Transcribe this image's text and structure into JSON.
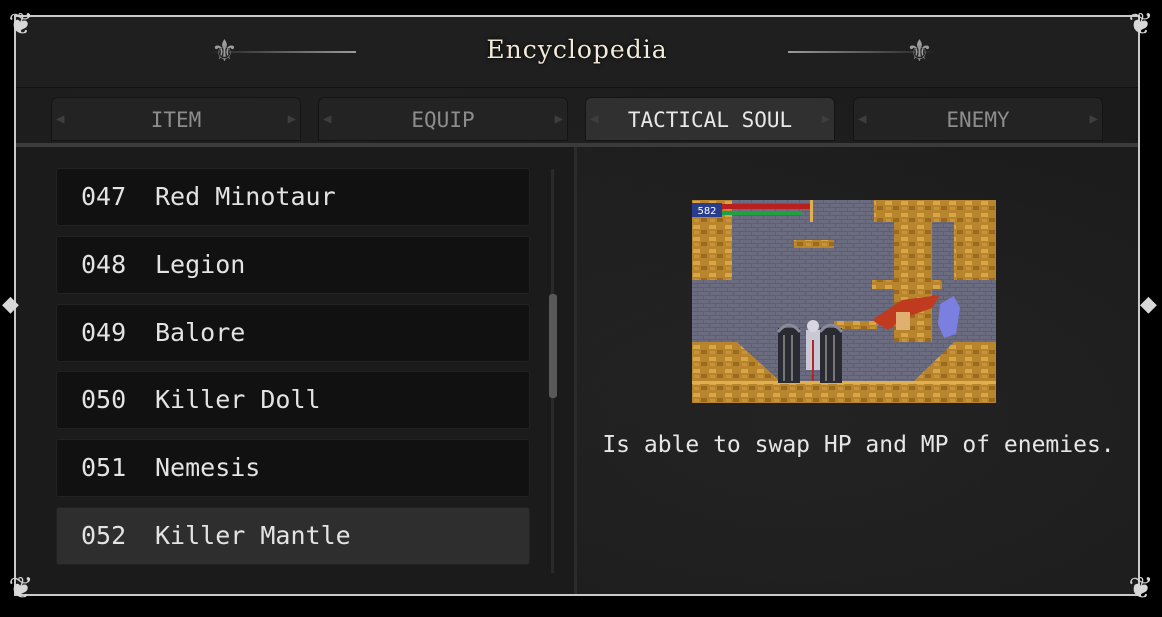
{
  "header": {
    "title": "Encyclopedia"
  },
  "tabs": [
    {
      "label": "ITEM",
      "active": false
    },
    {
      "label": "EQUIP",
      "active": false
    },
    {
      "label": "TACTICAL SOUL",
      "active": true
    },
    {
      "label": "ENEMY",
      "active": false
    }
  ],
  "list": {
    "items": [
      {
        "number": "047",
        "name": "Red Minotaur"
      },
      {
        "number": "048",
        "name": "Legion"
      },
      {
        "number": "049",
        "name": "Balore"
      },
      {
        "number": "050",
        "name": "Killer Doll"
      },
      {
        "number": "051",
        "name": "Nemesis"
      },
      {
        "number": "052",
        "name": "Killer Mantle"
      }
    ],
    "selected_index": 5
  },
  "detail": {
    "preview": {
      "hud_value": "582"
    },
    "description": "Is able to swap HP and MP of enemies."
  },
  "colors": {
    "frame": "#c9c9c9",
    "panel": "#1b1b1b",
    "row": "#111111",
    "row_selected": "#2e2e2e",
    "title": "#f2ead8"
  }
}
